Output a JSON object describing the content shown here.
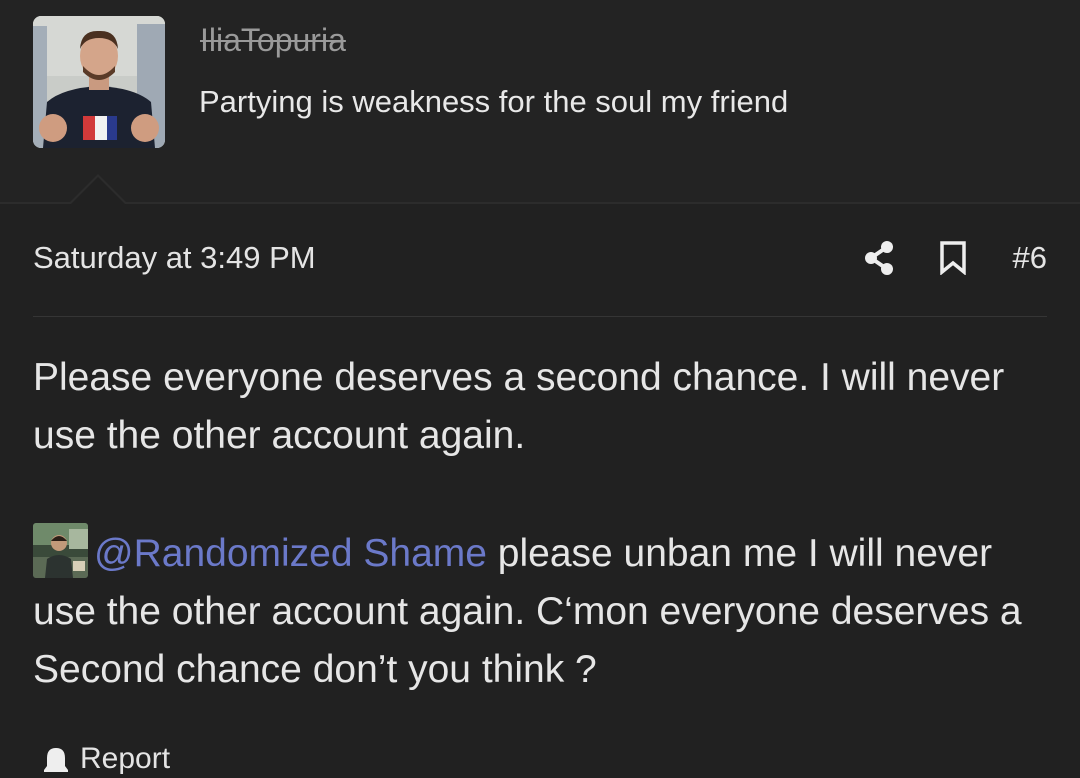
{
  "header": {
    "username": "IliaTopuria",
    "user_title": "Partying is weakness for the soul my friend"
  },
  "post": {
    "date": "Saturday at 3:49 PM",
    "number": "#6",
    "paragraph1": "Please everyone deserves a second chance. I will never use the other account again.",
    "mention": "@Randomized Shame",
    "paragraph2_rest": " please unban me I will never use the other account again. C‘mon everyone deserves a Second chance don’t you think ?",
    "report_label": "Report"
  },
  "icons": {
    "share": "share-icon",
    "bookmark": "bookmark-icon",
    "report": "report-icon"
  },
  "colors": {
    "background": "#212121",
    "header_background": "#232323",
    "text": "#e6e6e6",
    "muted": "#9a9a9a",
    "mention": "#6b79c9"
  }
}
